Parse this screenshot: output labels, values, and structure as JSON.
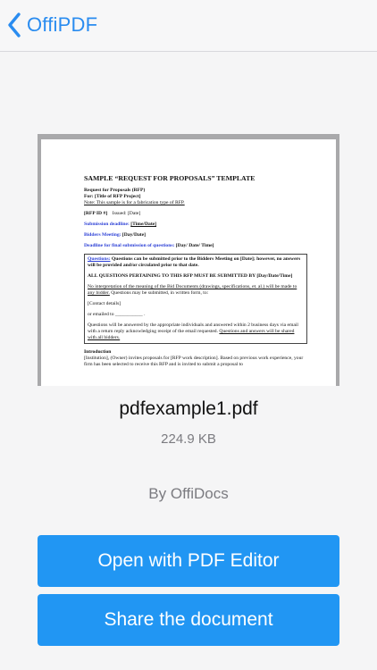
{
  "navbar": {
    "back_label": "OffiPDF",
    "accent": "#2a8cf0"
  },
  "preview": {
    "title": "SAMPLE “REQUEST FOR PROPOSALS” TEMPLATE",
    "line1": "Request for Proposals  (RFP)",
    "line2": "For: [Title of RFP Project]",
    "line3": "Note: This sample is for a fabrication type of RFP.",
    "rfp_id_label": "[RFP ID #]",
    "issued": "Issued:   [Date]",
    "submission_label": "Submission deadline:",
    "submission_value": "[Time/Date]",
    "bidders_label": "Bidders Meeting:",
    "bidders_value": "[Day/Date]",
    "deadline_label": "Deadline for final submission of questions:",
    "deadline_value": "[Day/ Date/ Time]",
    "questions_label": "Questions:",
    "questions_text": "Questions can be submitted prior to the Bidders Meeting on [Date]; however, no answers will be provided and/or circulated prior to that date.",
    "all_questions": "ALL QUESTIONS PERTAINING TO THIS RFP MUST BE SUBMITTED BY [Day/Date/Time]",
    "no_interp_u": "No interpretation of the meaning of the Bid Documents (drawings, specifications, et. al.) will be made to any bidder.",
    "no_interp_rest": "  Questions may be submitted, in written form, to:",
    "contact": "[Contact details]",
    "emailed": "or emailed to ___________ .",
    "answered": "Questions will be answered by the appropriate individuals and answered within 2 business days via email with a return reply acknowledging receipt of the email requested.  ",
    "answered_u": "Questions and answers will be shared with all bidders.",
    "intro_heading": "Introduction",
    "intro_text": "[Institution], (Owner)  invites proposals for [RFP work description].  Based on previous work experience, your firm has been selected to receive this RFP and is invited to submit a proposal to"
  },
  "file": {
    "name": "pdfexample1.pdf",
    "size": "224.9 KB"
  },
  "author": "By OffiDocs",
  "buttons": {
    "open": "Open with PDF Editor",
    "share": "Share the document",
    "color": "#2196f3"
  }
}
